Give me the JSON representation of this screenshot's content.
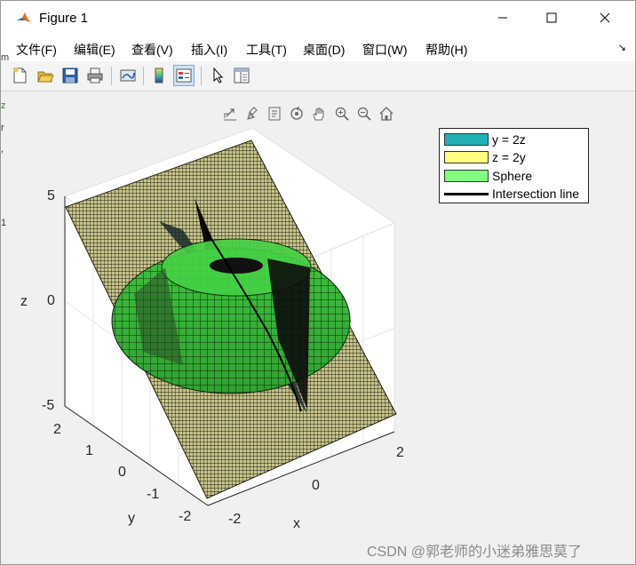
{
  "window": {
    "title": "Figure 1"
  },
  "menu": [
    {
      "label": "文件(F)"
    },
    {
      "label": "编辑(E)"
    },
    {
      "label": "查看(V)"
    },
    {
      "label": "插入(I)"
    },
    {
      "label": "工具(T)"
    },
    {
      "label": "桌面(D)"
    },
    {
      "label": "窗口(W)"
    },
    {
      "label": "帮助(H)"
    }
  ],
  "toolbar_icons": [
    "new-figure-icon",
    "open-file-icon",
    "save-icon",
    "print-icon",
    "link-plot-icon",
    "colorbar-icon",
    "legend-icon",
    "select-pointer-icon",
    "property-inspector-icon"
  ],
  "axes_toolbar_icons": [
    "export-icon",
    "brush-icon",
    "data-tip-icon",
    "rotate-3d-icon",
    "pan-icon",
    "zoom-in-icon",
    "zoom-out-icon",
    "home-icon"
  ],
  "legend": [
    {
      "label": "y = 2z",
      "color": "#20b2b2",
      "kind": "patch"
    },
    {
      "label": "z = 2y",
      "color": "#ffff80",
      "kind": "patch"
    },
    {
      "label": "Sphere",
      "color": "#80ff80",
      "kind": "patch"
    },
    {
      "label": "Intersection line",
      "color": "#000000",
      "kind": "line"
    }
  ],
  "axes": {
    "x_label": "x",
    "y_label": "y",
    "z_label": "z",
    "x_ticks": [
      "-2",
      "0",
      "2"
    ],
    "y_ticks": [
      "2",
      "1",
      "0",
      "-1",
      "-2"
    ],
    "z_ticks": [
      "5",
      "0",
      "-5"
    ]
  },
  "watermark": "CSDN @郭老师的小迷弟雅思莫了"
}
